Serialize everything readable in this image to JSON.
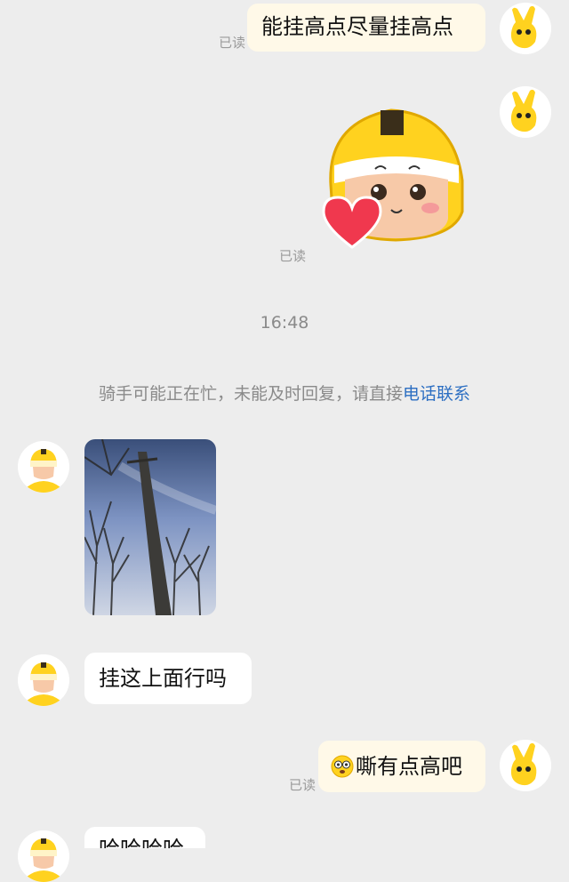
{
  "messages": {
    "m1": {
      "text": "能挂高点尽量挂高点",
      "read": "已读"
    },
    "m2": {
      "read": "已读",
      "sticker": "helmet-face-heart-sticker"
    },
    "timestamp": "16:48",
    "system": {
      "text": "骑手可能正在忙，未能及时回复，请直接",
      "link": "电话联系"
    },
    "m3": {
      "photo": "utility-pole-photo"
    },
    "m4": {
      "text": "挂这上面行吗"
    },
    "m5": {
      "text": "嘶有点高吧",
      "read": "已读",
      "emoji": "dizzy-eyes-emoji"
    },
    "m6": {
      "text": "哈哈哈哈"
    }
  },
  "colors": {
    "background": "#ededed",
    "sent_bubble": "#fff9e8",
    "received_bubble": "#ffffff",
    "link": "#2d6fc2",
    "helmet_yellow": "#ffd21f"
  }
}
